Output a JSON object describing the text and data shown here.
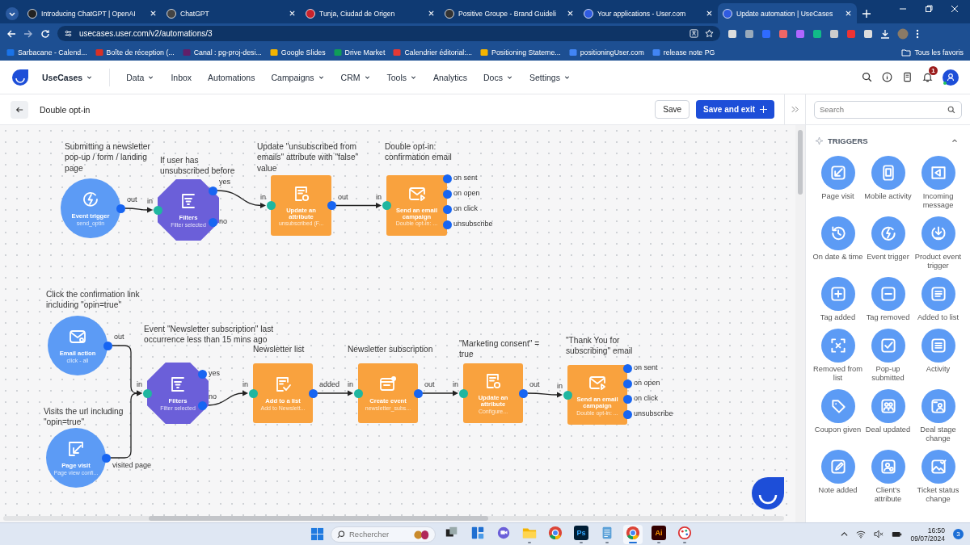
{
  "browser": {
    "tabs": [
      {
        "title": "Introducing ChatGPT | OpenAI",
        "selected": false
      },
      {
        "title": "ChatGPT",
        "selected": false
      },
      {
        "title": "Tunja, Ciudad de Origen",
        "selected": false
      },
      {
        "title": "Positive Groupe - Brand Guideli",
        "selected": false
      },
      {
        "title": "Your applications - User.com",
        "selected": false
      },
      {
        "title": "Update automation | UseCases",
        "selected": true
      }
    ],
    "address": "usecases.user.com/v2/automations/3",
    "bookmarks": [
      "Sarbacane - Calend...",
      "Boîte de réception (...",
      "Canal : pg-proj-desi...",
      "Google Slides",
      "Drive Market",
      "Calendrier éditorial:...",
      "Positioning Stateme...",
      "positioningUser.com",
      "release note PG"
    ],
    "all_bookmarks": "Tous les favoris"
  },
  "header": {
    "brand": "UseCases",
    "nav": [
      {
        "label": "Data",
        "dropdown": true
      },
      {
        "label": "Inbox",
        "dropdown": false
      },
      {
        "label": "Automations",
        "dropdown": false
      },
      {
        "label": "Campaigns",
        "dropdown": true
      },
      {
        "label": "CRM",
        "dropdown": true
      },
      {
        "label": "Tools",
        "dropdown": true
      },
      {
        "label": "Analytics",
        "dropdown": false
      },
      {
        "label": "Docs",
        "dropdown": true
      },
      {
        "label": "Settings",
        "dropdown": true
      }
    ],
    "notification_count": "1"
  },
  "toolbar": {
    "title": "Double opt-in",
    "save": "Save",
    "save_and_exit": "Save and exit"
  },
  "flow": {
    "nodes": [
      {
        "kind": "event_trigger",
        "caption": "Submitting a newsletter pop-up / form / landing page",
        "title": "Event trigger",
        "subtitle": "send_optin",
        "outputs": [
          {
            "label": "out",
            "connected": true
          }
        ]
      },
      {
        "kind": "filter",
        "caption": "If user has unsubscribed before",
        "title": "Filters",
        "subtitle": "Filter selected",
        "input": "in",
        "outputs": [
          {
            "label": "yes",
            "connected": true
          },
          {
            "label": "no",
            "connected": false
          }
        ]
      },
      {
        "kind": "update_attribute",
        "caption": "Update \"unsubscribed from emails\" attribute with \"false\" value",
        "title": "Update an attribute",
        "subtitle": "unsubscribed (F...",
        "input": "in",
        "outputs": [
          {
            "label": "out",
            "connected": true
          }
        ]
      },
      {
        "kind": "send_email",
        "caption": "Double opt-in: confirmation email",
        "title": "Send an email campaign",
        "subtitle": "Double opt-in: ...",
        "input": "in",
        "outputs": [
          {
            "label": "on sent",
            "connected": false
          },
          {
            "label": "on open",
            "connected": false
          },
          {
            "label": "on click",
            "connected": false
          },
          {
            "label": "unsubscribe",
            "connected": false
          }
        ]
      },
      {
        "kind": "email_action",
        "caption": "Click the confirmation link including \"opin=true\"",
        "title": "Email action",
        "subtitle": "click - all",
        "outputs": [
          {
            "label": "out",
            "connected": true
          }
        ]
      },
      {
        "kind": "page_visit",
        "caption": "Visits the url including \"opin=true\"",
        "title": "Page visit",
        "subtitle": "Page view confi...",
        "outputs": [
          {
            "label": "visited page",
            "connected": true
          }
        ]
      },
      {
        "kind": "filter",
        "caption": "Event \"Newsletter subscription\" last occurrence less than 15 mins ago",
        "title": "Filters",
        "subtitle": "Filter selected",
        "input": "in",
        "outputs": [
          {
            "label": "yes",
            "connected": false
          },
          {
            "label": "no",
            "connected": true
          }
        ]
      },
      {
        "kind": "add_to_list",
        "caption": "Newsletter list",
        "title": "Add to a list",
        "subtitle": "Add to Newslett...",
        "input": "in",
        "outputs": [
          {
            "label": "added",
            "connected": true
          }
        ]
      },
      {
        "kind": "create_event",
        "caption": "Newsletter subscription",
        "title": "Create event",
        "subtitle": "newsletter_subs...",
        "input": "in",
        "outputs": [
          {
            "label": "out",
            "connected": true
          }
        ]
      },
      {
        "kind": "update_attribute",
        "caption": "\"Marketing consent\" = true",
        "title": "Update an attribute",
        "subtitle": "Configure...",
        "input": "in",
        "outputs": [
          {
            "label": "out",
            "connected": true
          }
        ]
      },
      {
        "kind": "send_email",
        "caption": "\"Thank You for subscribing\" email",
        "title": "Send an email campaign",
        "subtitle": "Double opt-in: ...",
        "input": "in",
        "outputs": [
          {
            "label": "on sent",
            "connected": false
          },
          {
            "label": "on open",
            "connected": false
          },
          {
            "label": "on click",
            "connected": false
          },
          {
            "label": "unsubscribe",
            "connected": false
          }
        ]
      }
    ]
  },
  "panel": {
    "search_placeholder": "Search",
    "section": "TRIGGERS",
    "expanded": true,
    "items": [
      "Page visit",
      "Mobile activity",
      "Incoming message",
      "On date & time",
      "Event trigger",
      "Product event trigger",
      "Tag added",
      "Tag removed",
      "Added to list",
      "Removed from list",
      "Pop-up submitted",
      "Activity",
      "Coupon given",
      "Deal updated",
      "Deal stage change",
      "Note added",
      "Client's attribute",
      "Ticket status change"
    ]
  },
  "taskbar": {
    "search_placeholder": "Rechercher",
    "apps": [
      {
        "kind": "task_view",
        "running": false,
        "active": false
      },
      {
        "kind": "widgets",
        "running": false,
        "active": false
      },
      {
        "kind": "chat",
        "running": false,
        "active": false
      },
      {
        "kind": "folder",
        "running": true,
        "active": false
      },
      {
        "kind": "chrome",
        "running": false,
        "active": false
      },
      {
        "kind": "photoshop",
        "label": "Ps",
        "running": true,
        "active": false
      },
      {
        "kind": "notepad",
        "running": true,
        "active": false
      },
      {
        "kind": "chrome",
        "running": true,
        "active": true
      },
      {
        "kind": "illustrator",
        "label": "Ai",
        "running": true,
        "active": false
      },
      {
        "kind": "paint",
        "running": true,
        "active": false
      }
    ],
    "time": "16:50",
    "date": "09/07/2024",
    "notification_count": "3"
  }
}
